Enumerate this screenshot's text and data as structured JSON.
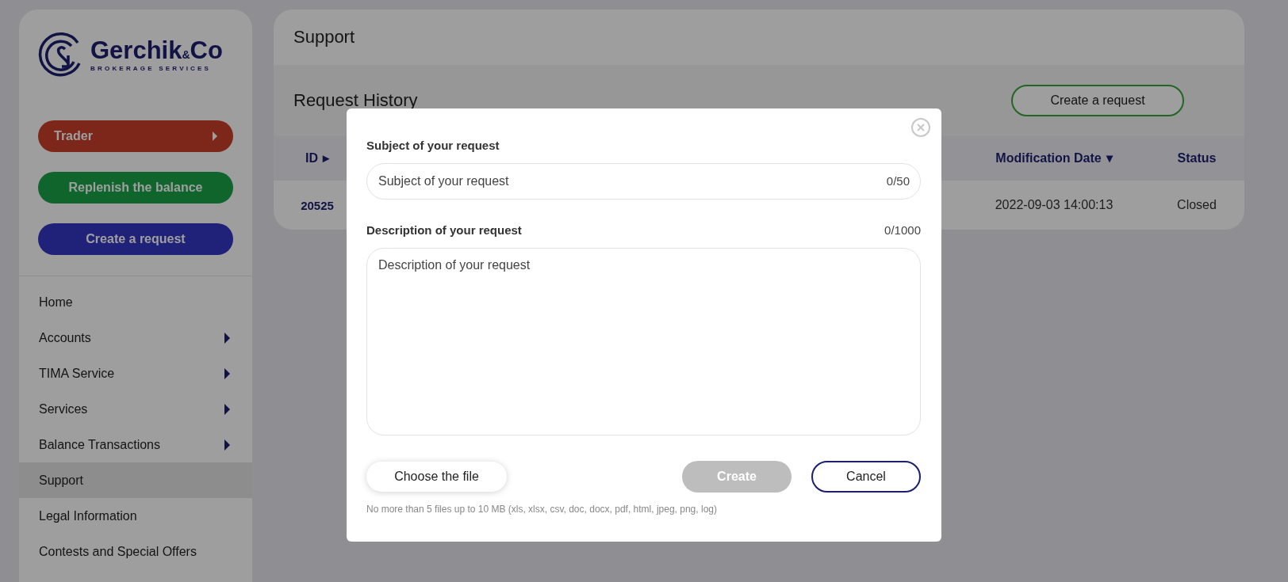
{
  "sidebar": {
    "logo": {
      "name": "Gerchik$_{&}$Co",
      "tagline": "BROKERAGE SERVICES"
    },
    "actions": [
      {
        "label": "Trader",
        "kind": "trader"
      },
      {
        "label": "Replenish the balance",
        "kind": "deposit"
      },
      {
        "label": "Create a request",
        "kind": "request"
      }
    ],
    "items": [
      {
        "label": "Home",
        "has_submenu": false,
        "selected": false
      },
      {
        "label": "Accounts",
        "has_submenu": true,
        "selected": false
      },
      {
        "label": "TIMA Service",
        "has_submenu": true,
        "selected": false
      },
      {
        "label": "Services",
        "has_submenu": true,
        "selected": false
      },
      {
        "label": "Balance Transactions",
        "has_submenu": true,
        "selected": false
      },
      {
        "label": "Support",
        "has_submenu": false,
        "selected": true
      },
      {
        "label": "Legal Information",
        "has_submenu": false,
        "selected": false
      },
      {
        "label": "Contests and Special Offers",
        "has_submenu": false,
        "selected": false
      }
    ]
  },
  "page": {
    "title": "Support",
    "section_title": "Request History",
    "create_button": "Create a request",
    "table": {
      "columns": [
        {
          "label": "ID",
          "sort_arrow": "▸"
        },
        {
          "label": "Modification Date",
          "sort_arrow": "▾"
        },
        {
          "label": "Status"
        }
      ],
      "rows": [
        {
          "cells": [
            "20525",
            "2022-09-03 14:00:13",
            "Closed"
          ]
        }
      ]
    }
  },
  "modal": {
    "subject": {
      "label": "Subject of your request",
      "placeholder": "Subject of your request",
      "counter": "0/50"
    },
    "description": {
      "label": "Description of your request",
      "placeholder": "Description of your request",
      "counter": "0/1000"
    },
    "file_button": "Choose the file",
    "buttons": [
      {
        "label": "Create",
        "kind": "primary",
        "disabled": true
      },
      {
        "label": "Cancel",
        "kind": "secondary",
        "disabled": false
      }
    ],
    "note": "No more than 5 files up to 10 MB (xls, xlsx, csv, doc, docx, pdf, html, jpeg, png, log)"
  }
}
